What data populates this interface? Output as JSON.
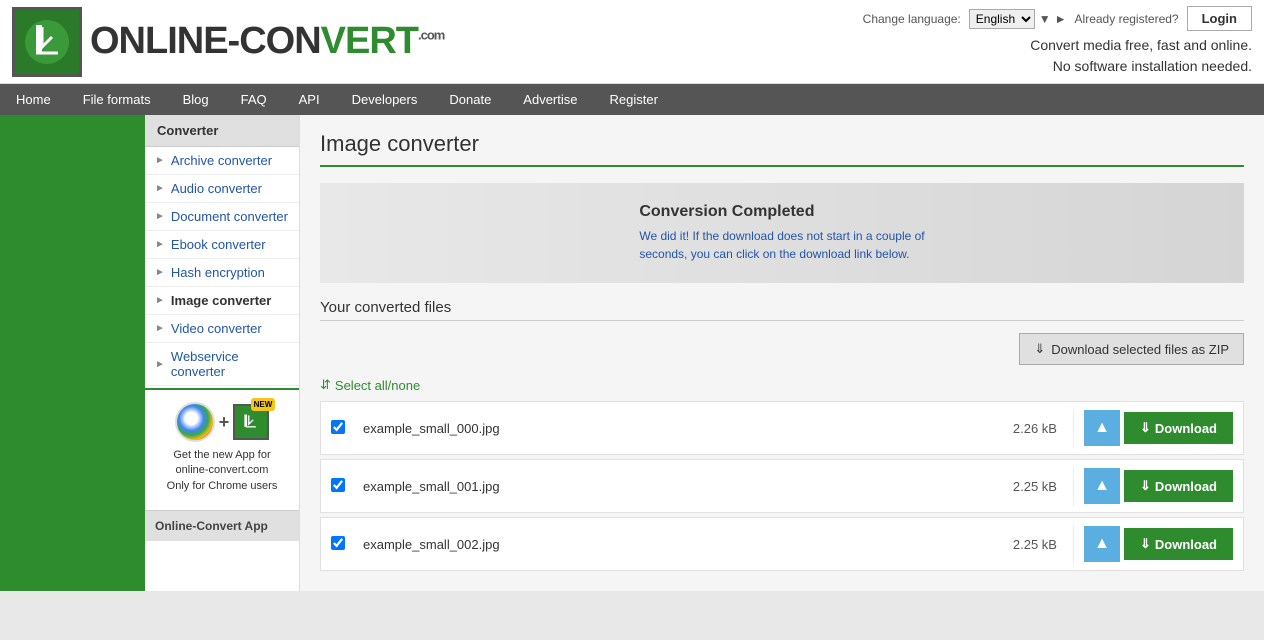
{
  "header": {
    "logo_text_before": "ONLINE-CON",
    "logo_text_after": "VERT",
    "logo_com": ".com",
    "tagline_line1": "Convert media free, fast and online.",
    "tagline_line2": "No software installation needed.",
    "lang_label": "Change language:",
    "lang_value": "English",
    "already_reg": "Already registered?",
    "login_label": "Login"
  },
  "nav": {
    "items": [
      "Home",
      "File formats",
      "Blog",
      "FAQ",
      "API",
      "Developers",
      "Donate",
      "Advertise",
      "Register"
    ]
  },
  "sidebar": {
    "converter_label": "Converter",
    "items": [
      {
        "label": "Archive converter"
      },
      {
        "label": "Audio converter"
      },
      {
        "label": "Document converter"
      },
      {
        "label": "Ebook converter"
      },
      {
        "label": "Hash encryption"
      },
      {
        "label": "Image converter"
      },
      {
        "label": "Video converter"
      },
      {
        "label": "Webservice converter"
      }
    ]
  },
  "promo": {
    "new_badge": "NEW",
    "plus": "+",
    "line1": "Get the new App for",
    "line2": "online-convert.com",
    "line3": "Only for Chrome users"
  },
  "oc_app": {
    "label": "Online-Convert App"
  },
  "main": {
    "page_title": "Image converter",
    "conversion": {
      "title": "Conversion Completed",
      "desc_line1": "We did it! If the download does not start in a couple of",
      "desc_line2": "seconds, you can click on the download link below."
    },
    "your_files": "Your converted files",
    "zip_btn_label": "Download selected files as ZIP",
    "select_all": "Select all/none",
    "files": [
      {
        "name": "example_small_000.jpg",
        "size": "2.26 kB"
      },
      {
        "name": "example_small_001.jpg",
        "size": "2.25 kB"
      },
      {
        "name": "example_small_002.jpg",
        "size": "2.25 kB"
      }
    ],
    "download_label": "Download",
    "download_icon": "⬇",
    "cloud_icon": "☁"
  }
}
